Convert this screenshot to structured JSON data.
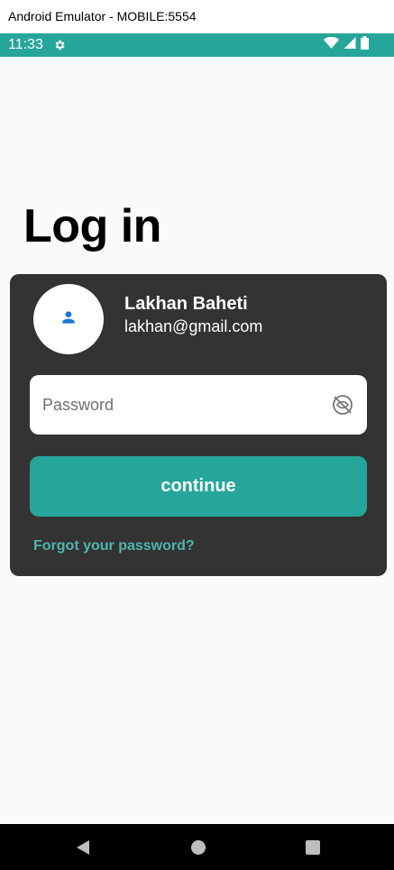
{
  "window": {
    "title": "Android Emulator - MOBILE:5554"
  },
  "status_bar": {
    "time": "11:33",
    "color": "#26a69a",
    "icons": [
      "gear-icon",
      "wifi-icon",
      "signal-icon",
      "battery-icon"
    ]
  },
  "login": {
    "title": "Log in",
    "user": {
      "name": "Lakhan Baheti",
      "email": "lakhan@gmail.com",
      "avatar_icon": "person-icon"
    },
    "password": {
      "placeholder": "Password",
      "value": "",
      "toggle_icon": "eye-off-icon"
    },
    "continue_label": "continue",
    "forgot_label": "Forgot your password?"
  },
  "nav_bar": {
    "buttons": [
      "back-icon",
      "home-icon",
      "recents-icon"
    ]
  },
  "colors": {
    "accent": "#26a69a",
    "link": "#4db6ac",
    "card": "#333333",
    "avatar_icon": "#1976d2"
  }
}
